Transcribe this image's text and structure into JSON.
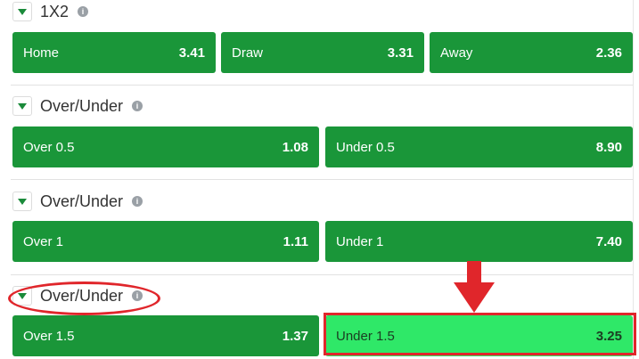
{
  "colors": {
    "odd_bg": "#1a9639",
    "odd_selected_bg": "#2fe868",
    "annotation_red": "#e0262b",
    "toggle_arrow": "#1a8a3a"
  },
  "markets": [
    {
      "title": "1X2",
      "info_icon": "info-icon",
      "outcomes": [
        {
          "label": "Home",
          "price": "3.41"
        },
        {
          "label": "Draw",
          "price": "3.31"
        },
        {
          "label": "Away",
          "price": "2.36"
        }
      ]
    },
    {
      "title": "Over/Under",
      "info_icon": "info-icon",
      "outcomes": [
        {
          "label": "Over 0.5",
          "price": "1.08"
        },
        {
          "label": "Under 0.5",
          "price": "8.90"
        }
      ]
    },
    {
      "title": "Over/Under",
      "info_icon": "info-icon",
      "outcomes": [
        {
          "label": "Over 1",
          "price": "1.11"
        },
        {
          "label": "Under 1",
          "price": "7.40"
        }
      ]
    },
    {
      "title": "Over/Under",
      "info_icon": "info-icon",
      "outcomes": [
        {
          "label": "Over 1.5",
          "price": "1.37"
        },
        {
          "label": "Under 1.5",
          "price": "3.25",
          "selected": true
        }
      ]
    }
  ],
  "annotations": {
    "highlighted_outcome": "Under 1.5",
    "circled_market": "Over/Under",
    "arrow": "down-arrow"
  }
}
